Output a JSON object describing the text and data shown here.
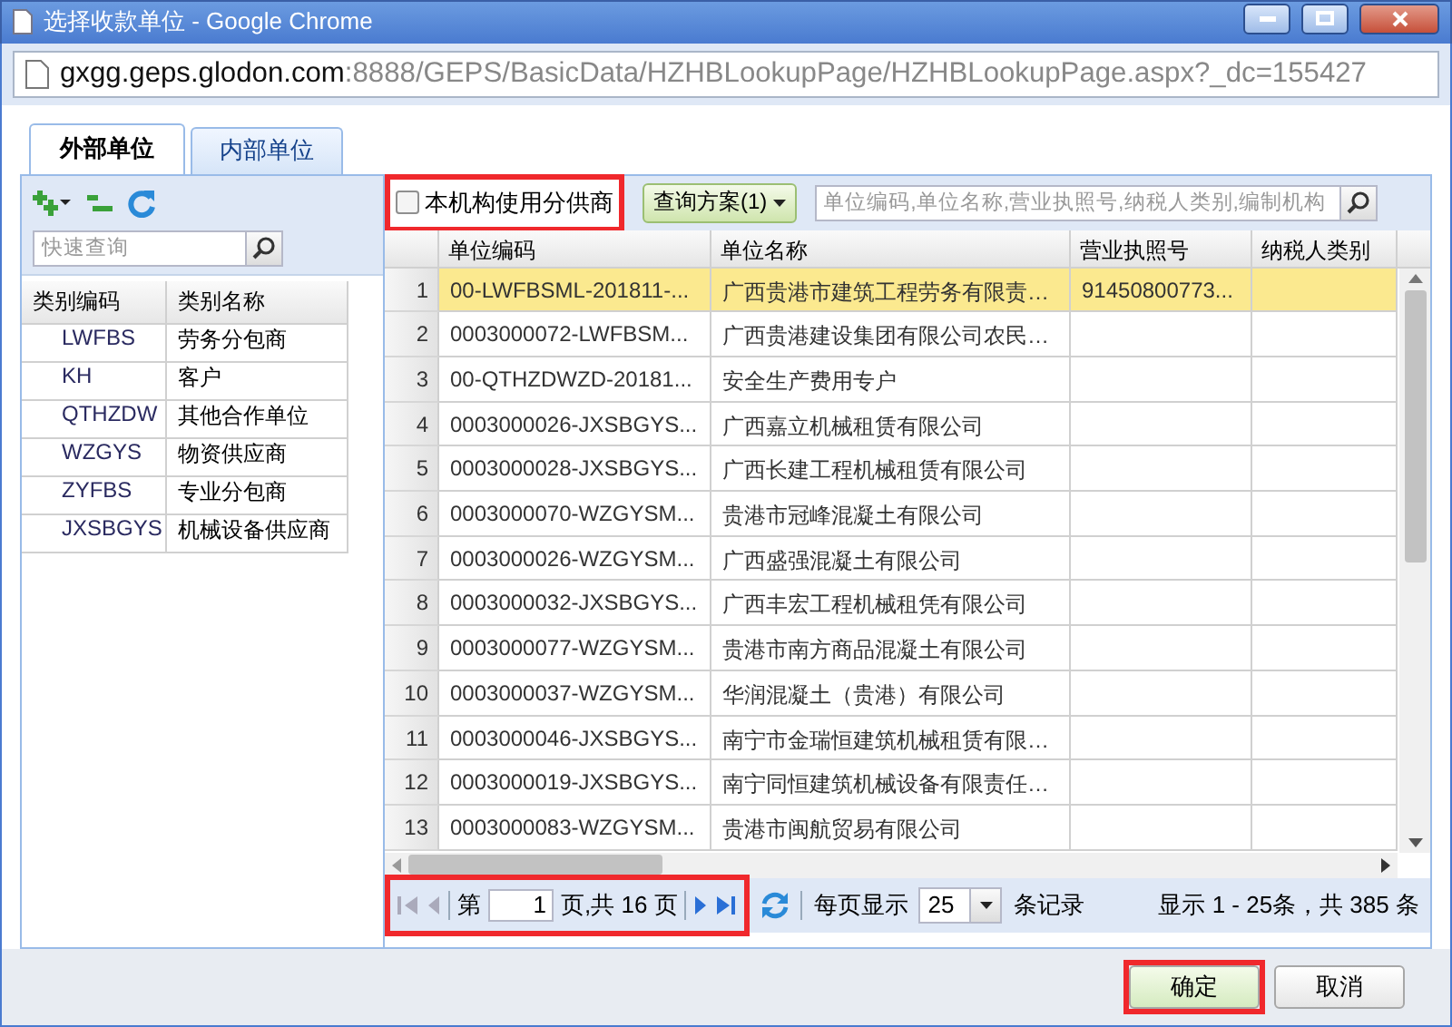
{
  "window": {
    "title": "选择收款单位 - Google Chrome"
  },
  "address_bar": {
    "host": "gxgg.geps.glodon.com",
    "path": ":8888/GEPS/BasicData/HZHBLookupPage/HZHBLookupPage.aspx?_dc=155427"
  },
  "tabs": [
    {
      "label": "外部单位",
      "selected": true
    },
    {
      "label": "内部单位",
      "selected": false
    }
  ],
  "left_panel": {
    "search": {
      "placeholder": "快速查询"
    },
    "columns": [
      "类别编码",
      "类别名称"
    ],
    "rows": [
      [
        "LWFBS",
        "劳务分包商"
      ],
      [
        "KH",
        "客户"
      ],
      [
        "QTHZDW",
        "其他合作单位"
      ],
      [
        "WZGYS",
        "物资供应商"
      ],
      [
        "ZYFBS",
        "专业分包商"
      ],
      [
        "JXSBGYS",
        "机械设备供应商"
      ]
    ]
  },
  "right_toolbar": {
    "checkbox": {
      "label": "本机构使用分供商",
      "checked": false,
      "highlighted": true
    },
    "scheme_button": "查询方案(1)",
    "search": {
      "placeholder": "单位编码,单位名称,营业执照号,纳税人类别,编制机构"
    }
  },
  "grid": {
    "columns": [
      "单位编码",
      "单位名称",
      "营业执照号",
      "纳税人类别"
    ],
    "rows": [
      {
        "number": "1",
        "code": "00-LWFBSML-201811-...",
        "name": "广西贵港市建筑工程劳务有限责…",
        "license": "91450800773...",
        "selected": true
      },
      {
        "number": "2",
        "code": "0003000072-LWFBSM...",
        "name": "广西贵港建设集团有限公司农民…",
        "selected": false
      },
      {
        "number": "3",
        "code": "00-QTHZDWZD-20181...",
        "name": "安全生产费用专户",
        "selected": false
      },
      {
        "number": "4",
        "code": "0003000026-JXSBGYS...",
        "name": "广西嘉立机械租赁有限公司",
        "selected": false
      },
      {
        "number": "5",
        "code": "0003000028-JXSBGYS...",
        "name": "广西长建工程机械租赁有限公司",
        "selected": false
      },
      {
        "number": "6",
        "code": "0003000070-WZGYSM...",
        "name": "贵港市冠峰混凝土有限公司",
        "selected": false
      },
      {
        "number": "7",
        "code": "0003000026-WZGYSM...",
        "name": "广西盛强混凝土有限公司",
        "selected": false
      },
      {
        "number": "8",
        "code": "0003000032-JXSBGYS...",
        "name": "广西丰宏工程机械租凭有限公司",
        "selected": false
      },
      {
        "number": "9",
        "code": "0003000077-WZGYSM...",
        "name": "贵港市南方商品混凝土有限公司",
        "selected": false
      },
      {
        "number": "10",
        "code": "0003000037-WZGYSM...",
        "name": "华润混凝土（贵港）有限公司",
        "selected": false
      },
      {
        "number": "11",
        "code": "0003000046-JXSBGYS...",
        "name": "南宁市金瑞恒建筑机械租赁有限…",
        "selected": false
      },
      {
        "number": "12",
        "code": "0003000019-JXSBGYS...",
        "name": "南宁同恒建筑机械设备有限责任…",
        "selected": false
      },
      {
        "number": "13",
        "code": "0003000083-WZGYSM...",
        "name": "贵港市闽航贸易有限公司",
        "selected": false
      }
    ]
  },
  "pager": {
    "highlighted": true,
    "page_label": "第",
    "page": "1",
    "page_total": "页,共 16 页",
    "per_page_label": "每页显示",
    "per_page": "25",
    "records_label": "条记录",
    "summary": "显示 1 - 25条，共 385 条"
  },
  "buttons": [
    {
      "label": "确定",
      "primary": true,
      "highlighted": true
    },
    {
      "label": "取消",
      "primary": false,
      "highlighted": false
    }
  ]
}
